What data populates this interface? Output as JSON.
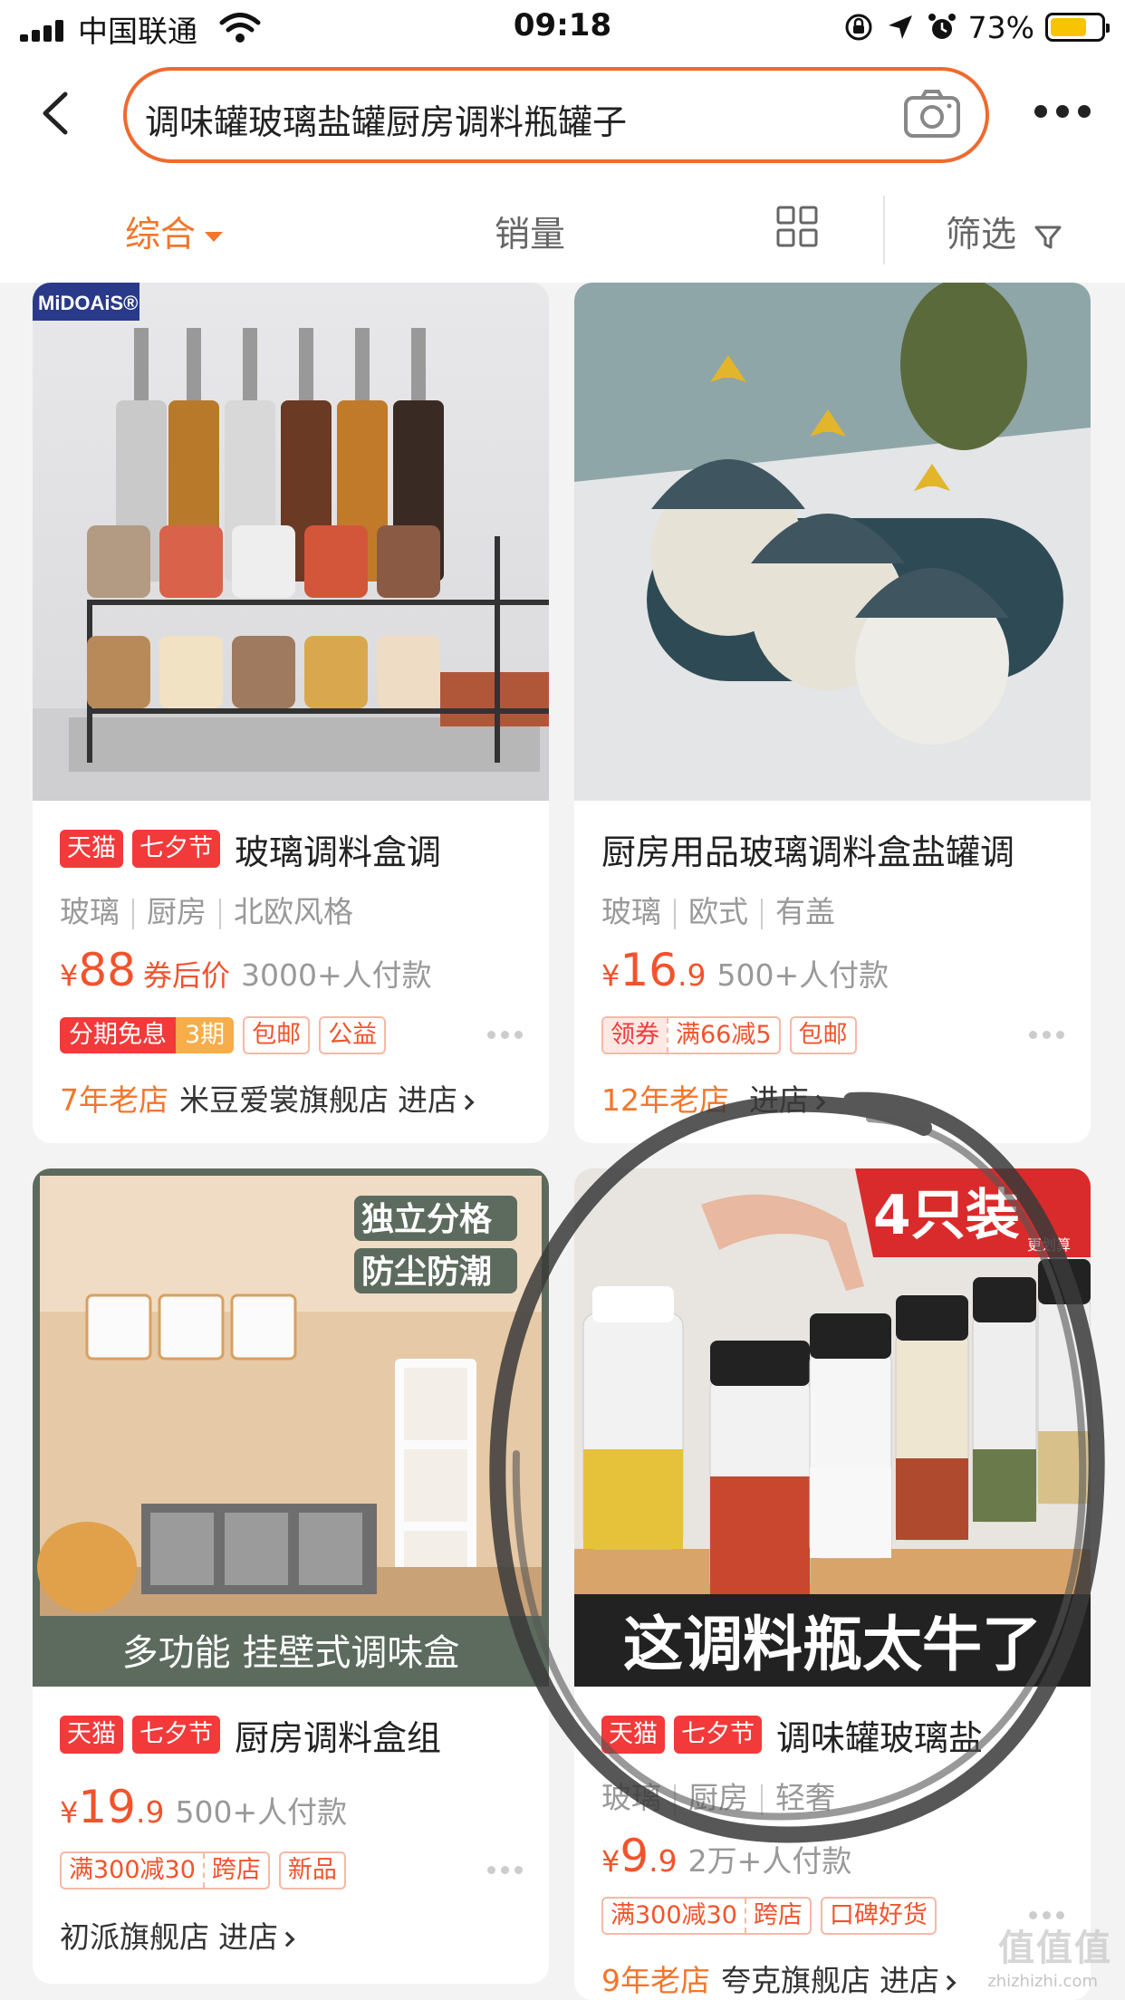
{
  "status_bar": {
    "carrier": "中国联通",
    "time": "09:18",
    "battery_percent": "73%",
    "battery_level": 0.73
  },
  "search": {
    "query": "调味罐玻璃盐罐厨房调料瓶罐子"
  },
  "sort_bar": {
    "comprehensive": "综合",
    "sales": "销量",
    "filter": "筛选"
  },
  "products": [
    {
      "image_overlay": {
        "logo": "MiDOAiS®"
      },
      "tags": [
        "天猫",
        "七夕节"
      ],
      "title": "玻璃调料盒调",
      "attributes": [
        "玻璃",
        "厨房",
        "北欧风格"
      ],
      "price_symbol": "¥",
      "price_int": "88",
      "price_dec": "",
      "price_note": "券后价",
      "sales": "3000+人付款",
      "installment": {
        "a": "分期免息",
        "b": "3期"
      },
      "badges": [
        "包邮",
        "公益"
      ],
      "shop_age": "7年老店",
      "shop_name": "米豆爱裳旗舰店",
      "shop_enter": "进店"
    },
    {
      "tags": [],
      "title": "厨房用品玻璃调料盒盐罐调",
      "attributes": [
        "玻璃",
        "欧式",
        "有盖"
      ],
      "price_symbol": "¥",
      "price_int": "16",
      "price_dec": ".9",
      "price_note": "",
      "sales": "500+人付款",
      "coupon": {
        "a": "领券",
        "b": "满66减5"
      },
      "badges": [
        "包邮"
      ],
      "shop_age": "12年老店",
      "shop_name": "",
      "shop_enter": "进店"
    },
    {
      "image_overlay": {
        "line1": "独立分格",
        "line2": "防尘防潮",
        "bottom": "多功能 挂壁式调味盒"
      },
      "tags": [
        "天猫",
        "七夕节"
      ],
      "title": "厨房调料盒组",
      "attributes": [],
      "price_symbol": "¥",
      "price_int": "19",
      "price_dec": ".9",
      "price_note": "",
      "sales": "500+人付款",
      "coupon_plain": {
        "a": "满300减30",
        "b": "跨店"
      },
      "badges": [
        "新品"
      ],
      "shop_age": "",
      "shop_name": "初派旗舰店",
      "shop_enter": "进店"
    },
    {
      "image_overlay": {
        "top": "4只装",
        "top_small": "更划算",
        "bottom": "这调料瓶太牛了"
      },
      "tags": [
        "天猫",
        "七夕节"
      ],
      "title": "调味罐玻璃盐",
      "attributes": [
        "玻璃",
        "厨房",
        "轻奢"
      ],
      "price_symbol": "¥",
      "price_int": "9",
      "price_dec": ".9",
      "price_note": "",
      "sales": "2万+人付款",
      "coupon_plain": {
        "a": "满300减30",
        "b": "跨店"
      },
      "badges": [
        "口碑好货"
      ],
      "shop_age": "9年老店",
      "shop_name": "夸克旗舰店",
      "shop_enter": "进店"
    }
  ],
  "watermark": {
    "main": "值值值",
    "sub": "zhizhizhi.com"
  },
  "colors": {
    "accent": "#f2762c",
    "price": "#f2532c",
    "tmall_red": "#f23a3a"
  }
}
